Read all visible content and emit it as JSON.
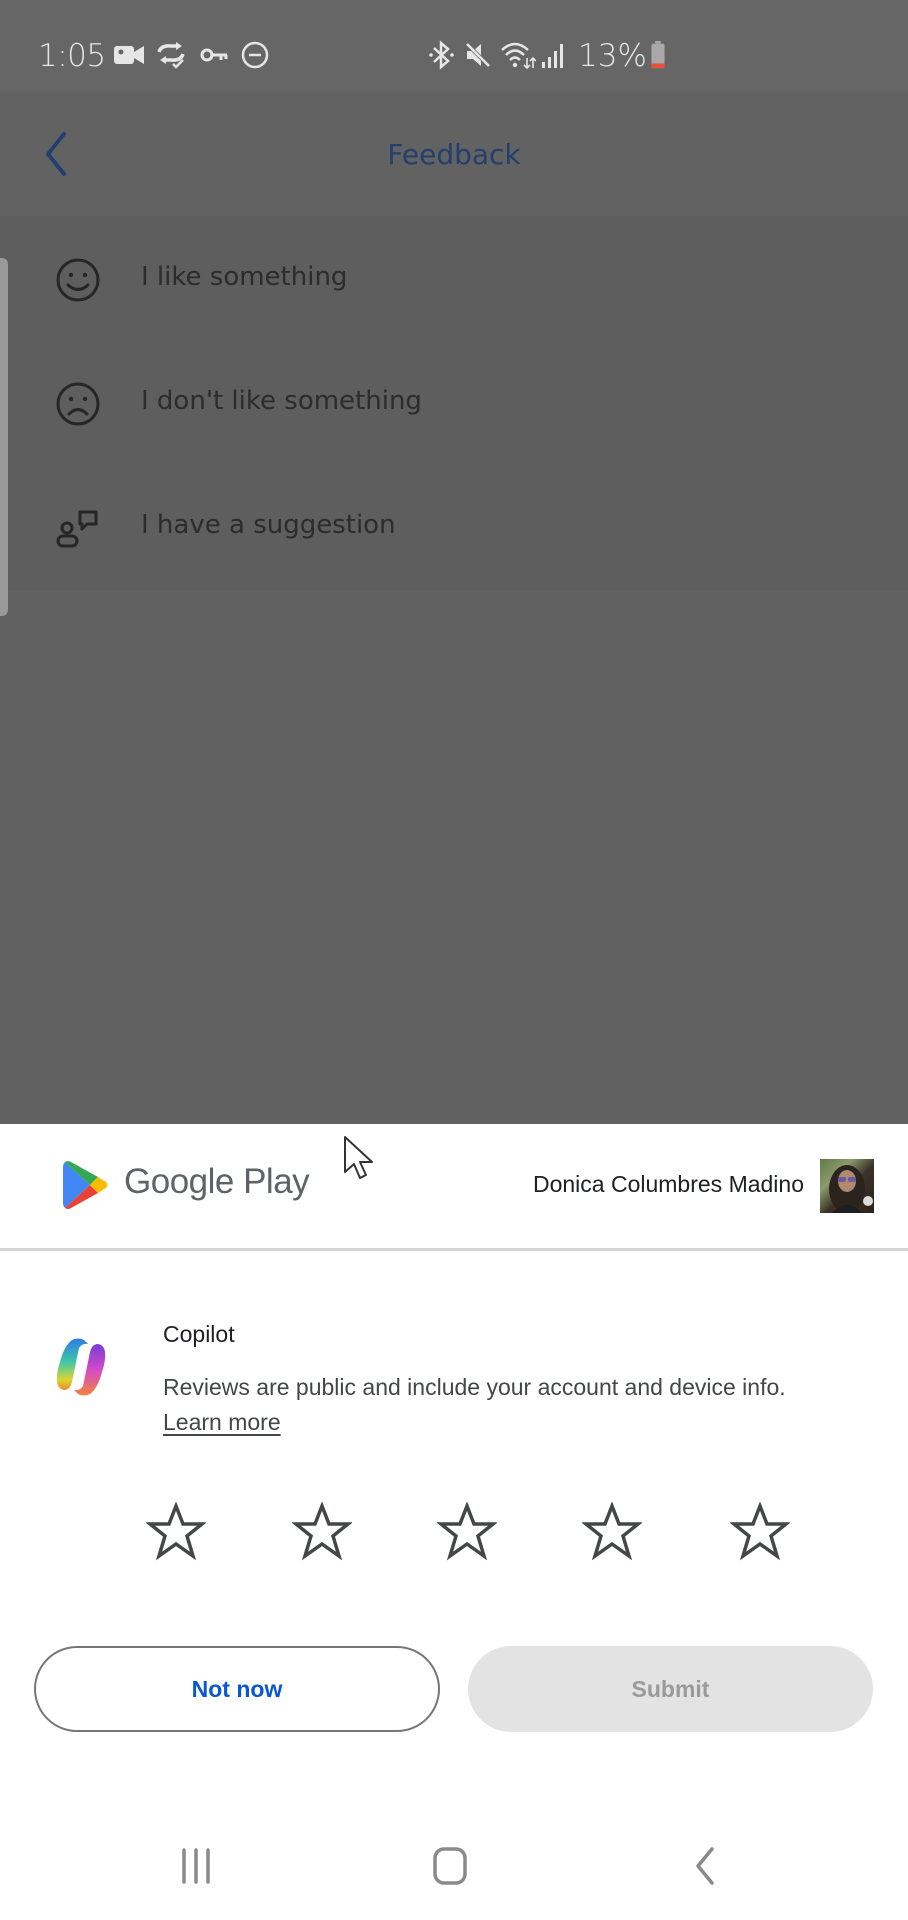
{
  "status_bar": {
    "time": "1:05",
    "left_icons": [
      "video-camera-icon",
      "sync-check-icon",
      "vpn-key-icon",
      "do-not-disturb-icon"
    ],
    "right_icons": [
      "bluetooth-icon",
      "mute-icon",
      "wifi-icon",
      "signal-icon"
    ],
    "battery_percent": "13%",
    "battery_level": 0.13,
    "battery_color": "#e5533c"
  },
  "background_app": {
    "header": {
      "title": "Feedback",
      "back_label": "Back"
    },
    "items": [
      {
        "icon": "smile-icon",
        "label": "I like something"
      },
      {
        "icon": "frown-icon",
        "label": "I don't like something"
      },
      {
        "icon": "suggestion-icon",
        "label": "I have a suggestion"
      }
    ]
  },
  "review_sheet": {
    "brand": "Google Play",
    "account_name": "Donica Columbres Madino",
    "app_name": "Copilot",
    "description": "Reviews are public and include your account and device info.",
    "learn_more": "Learn more",
    "rating": {
      "value": 0,
      "max": 5
    },
    "buttons": {
      "not_now": "Not now",
      "submit": "Submit"
    },
    "colors": {
      "accent": "#0b57d0",
      "disabled_bg": "#e3e3e3",
      "disabled_text": "#9a9a9a"
    }
  },
  "nav_bar": {
    "recents": "recents-icon",
    "home": "home-icon",
    "back": "back-icon"
  }
}
